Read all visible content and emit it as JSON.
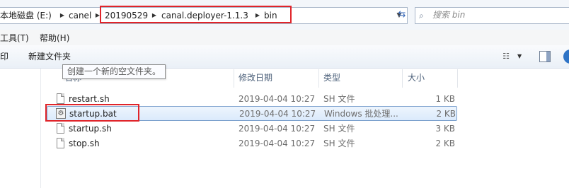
{
  "address_bar": {
    "crumbs": [
      "本地磁盘 (E:)",
      "canel",
      "20190529",
      "canal.deployer-1.1.3",
      "bin"
    ]
  },
  "search": {
    "placeholder": "搜索 bin"
  },
  "menu": {
    "items": [
      "工具(T)",
      "帮助(H)"
    ]
  },
  "command_bar": {
    "left_partial": "印",
    "new_folder": "新建文件夹"
  },
  "tooltip": "创建一个新的空文件夹。",
  "columns": {
    "name": "名称",
    "date": "修改日期",
    "type": "类型",
    "size": "大小"
  },
  "files": [
    {
      "name": "restart.sh",
      "date": "2019-04-04 10:27",
      "type": "SH 文件",
      "size": "1 KB"
    },
    {
      "name": "startup.bat",
      "date": "2019-04-04 10:27",
      "type": "Windows 批处理...",
      "size": "2 KB"
    },
    {
      "name": "startup.sh",
      "date": "2019-04-04 10:27",
      "type": "SH 文件",
      "size": "3 KB"
    },
    {
      "name": "stop.sh",
      "date": "2019-04-04 10:27",
      "type": "SH 文件",
      "size": "2 KB"
    }
  ],
  "colors": {
    "highlight_box": "#e0242a",
    "selection": "#dbeafc"
  }
}
